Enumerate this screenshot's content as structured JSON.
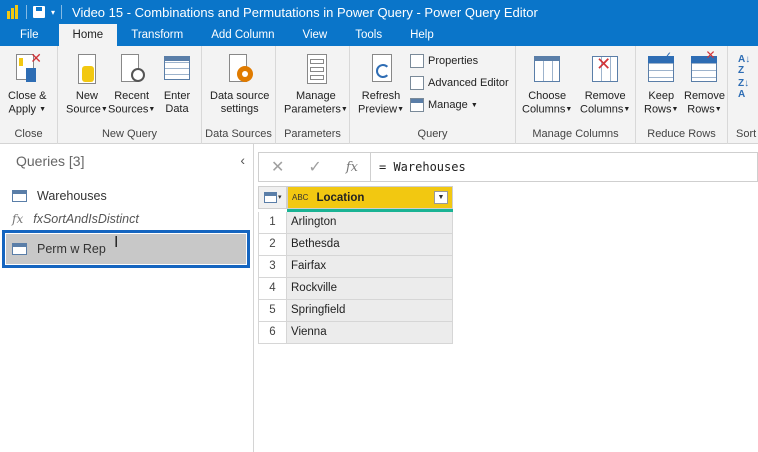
{
  "window": {
    "title": "Video 15 - Combinations and Permutations in Power Query - Power Query Editor"
  },
  "tabs": [
    "File",
    "Home",
    "Transform",
    "Add Column",
    "View",
    "Tools",
    "Help"
  ],
  "ribbon": {
    "close_apply": {
      "line1": "Close &",
      "line2": "Apply",
      "group": "Close"
    },
    "new_source": {
      "line1": "New",
      "line2": "Source"
    },
    "recent_sources": {
      "line1": "Recent",
      "line2": "Sources"
    },
    "enter_data": {
      "line1": "Enter",
      "line2": "Data"
    },
    "new_query_group": "New Query",
    "data_source_settings": {
      "line1": "Data source",
      "line2": "settings",
      "group": "Data Sources"
    },
    "manage_parameters": {
      "line1": "Manage",
      "line2": "Parameters",
      "group": "Parameters"
    },
    "refresh_preview": {
      "line1": "Refresh",
      "line2": "Preview"
    },
    "properties": "Properties",
    "advanced_editor": "Advanced Editor",
    "manage": "Manage",
    "query_group": "Query",
    "choose_columns": {
      "line1": "Choose",
      "line2": "Columns"
    },
    "remove_columns": {
      "line1": "Remove",
      "line2": "Columns"
    },
    "manage_columns_group": "Manage Columns",
    "keep_rows": {
      "line1": "Keep",
      "line2": "Rows"
    },
    "remove_rows": {
      "line1": "Remove",
      "line2": "Rows"
    },
    "reduce_rows_group": "Reduce Rows",
    "sort_group": "Sort"
  },
  "queries": {
    "header": "Queries [3]",
    "items": [
      {
        "name": "Warehouses",
        "kind": "table"
      },
      {
        "name": "fxSortAndIsDistinct",
        "kind": "function"
      },
      {
        "name": "Perm w Rep",
        "kind": "table"
      }
    ]
  },
  "formula_bar": {
    "fx": "fx",
    "formula": "= Warehouses"
  },
  "grid": {
    "column": "Location",
    "type_badge": "ABC",
    "rows": [
      {
        "n": "1",
        "value": "Arlington"
      },
      {
        "n": "2",
        "value": "Bethesda"
      },
      {
        "n": "3",
        "value": "Fairfax"
      },
      {
        "n": "4",
        "value": "Rockville"
      },
      {
        "n": "5",
        "value": "Springfield"
      },
      {
        "n": "6",
        "value": "Vienna"
      }
    ]
  },
  "colors": {
    "titlebar": "#0a75c9",
    "column_header": "#f2c811",
    "selection_border": "#1565c0"
  }
}
